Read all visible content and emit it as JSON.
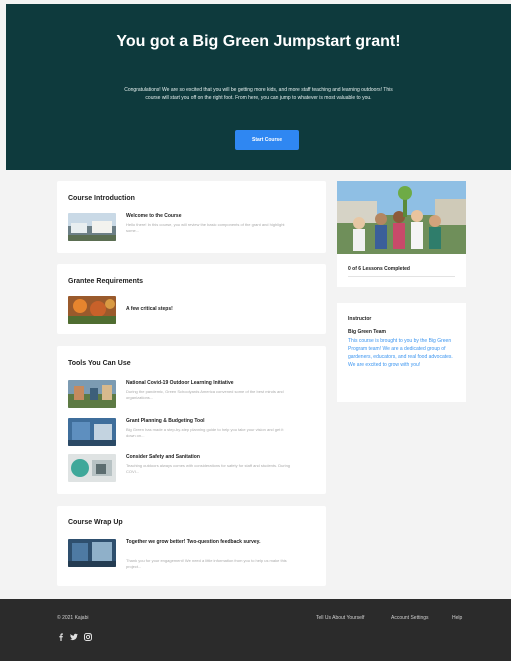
{
  "hero": {
    "title": "You got a Big Green Jumpstart grant!",
    "description": "Congratulations! We are so excited that you will be getting more kids, and more staff teaching and learning outdoors! This course will start you off on the right foot. From here, you can jump to whatever is most valuable to you.",
    "button_label": "Start Course",
    "background": "#0e3a3d",
    "accent": "#2f87f2"
  },
  "sections": {
    "intro": {
      "title": "Course Introduction",
      "lessons": [
        {
          "title": "Welcome to the Course",
          "desc": "Hello there! In this course, you will review the basic components of the grant and highlight some..."
        }
      ]
    },
    "requirements": {
      "title": "Grantee Requirements",
      "lessons": [
        {
          "title": "A few critical steps!",
          "desc": ""
        }
      ]
    },
    "tools": {
      "title": "Tools You Can Use",
      "lessons": [
        {
          "title": "National Covid-19 Outdoor Learning Initiative",
          "desc": "During the pandemic, Green Schoolyards America convened some of the best minds and organizations..."
        },
        {
          "title": "Grant Planning & Budgeting Tool",
          "desc": "Big Green has made a step-by-step planning guide to help you take your vision and get it down on..."
        },
        {
          "title": "Consider Safety and Sanitation",
          "desc": "Teaching outdoors always comes with considerations for safety for staff and students. During COVI..."
        }
      ]
    },
    "wrapup": {
      "title": "Course Wrap Up",
      "lessons": [
        {
          "title": "Together we grow better! Two-question feedback survey.",
          "desc": "Thank you for your engagement! We need a little information from you to help us make this project..."
        }
      ]
    }
  },
  "sidebar": {
    "progress_text": "0 of 6 Lessons Completed",
    "progress_fraction": 0,
    "instructor_label": "Instructor",
    "instructor_name": "Big Green Team",
    "instructor_bio": "This course is brought to you by the Big Green Program team! We are a dedicated group of gardeners, educators, and real food advocates. We are excited to grow with you!"
  },
  "footer": {
    "copyright": "© 2021 Kajabi",
    "links": [
      "Tell Us About Yourself",
      "Account Settings",
      "Help"
    ],
    "social_icons": [
      "facebook-icon",
      "twitter-icon",
      "instagram-icon"
    ]
  }
}
